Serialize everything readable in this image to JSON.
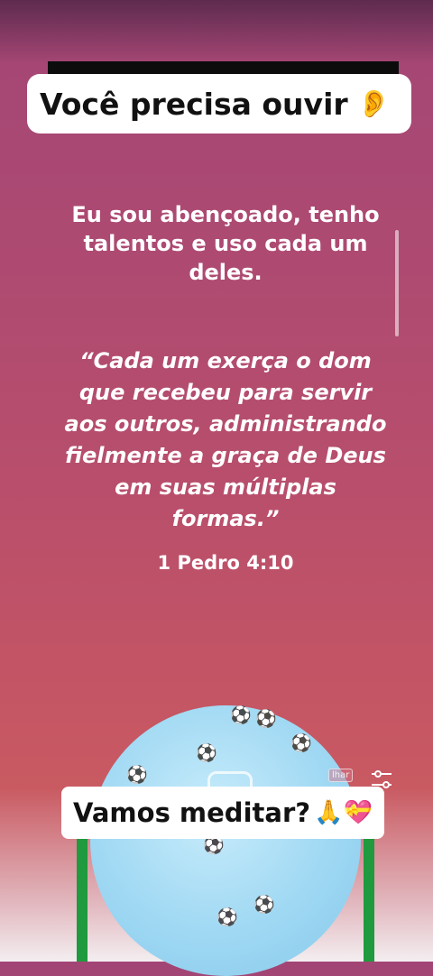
{
  "header_banner": {
    "text": "Você precisa ouvir",
    "emoji": "👂"
  },
  "affirmation": "Eu sou abençoado, tenho talentos e uso cada um deles.",
  "verse": {
    "text": "“Cada um exerça o dom que recebeu para servir aos outros, administrando fielmente a graça de Deus em suas múltiplas formas.”",
    "reference": "1 Pedro 4:10"
  },
  "overlay": {
    "partial_label": "lhar",
    "settings_icon": "sliders-icon"
  },
  "footer_banner": {
    "text": "Vamos meditar?",
    "emoji": "🙏💝"
  },
  "colors": {
    "background_top": "#a24575",
    "background_bottom": "#c95a62",
    "banner": "#ffffff",
    "globe": "#9fd8f3",
    "pole": "#1f9a3e"
  }
}
